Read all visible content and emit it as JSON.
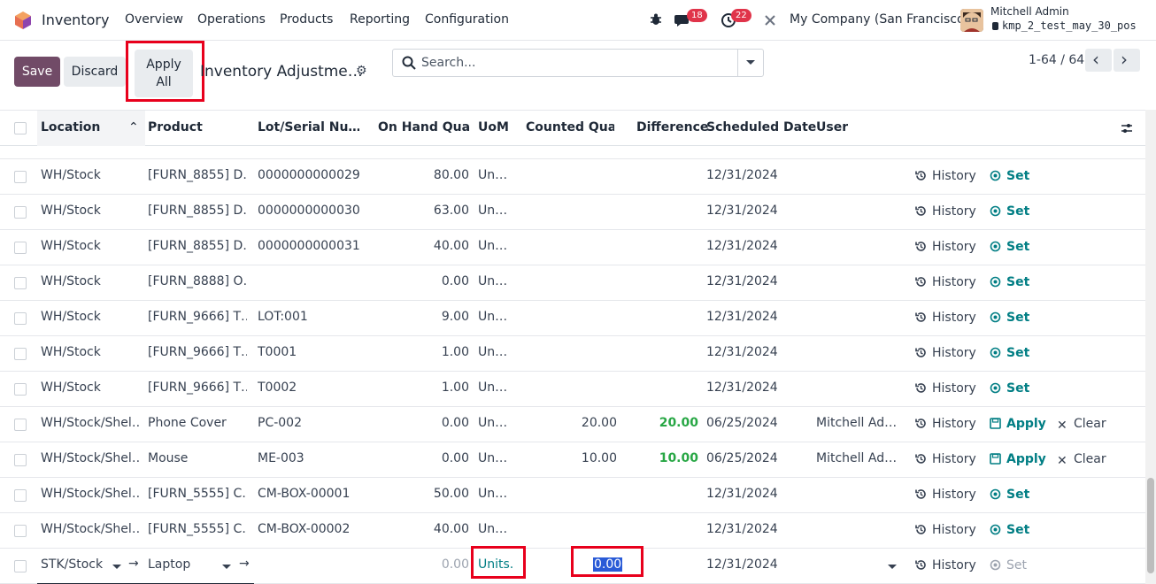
{
  "navbar": {
    "app_name": "Inventory",
    "menu": [
      "Overview",
      "Operations",
      "Products",
      "Reporting",
      "Configuration"
    ],
    "messages_count": "18",
    "activities_count": "22",
    "company": "My Company (San Francisco)",
    "user_name": "Mitchell Admin",
    "database": "kmp_2_test_may_30_pos"
  },
  "control_panel": {
    "save_label": "Save",
    "discard_label": "Discard",
    "apply_all_line1": "Apply",
    "apply_all_line2": "All",
    "breadcrumb": "Inventory Adjustme…",
    "search_placeholder": "Search...",
    "pager_value": "1-64 / 64"
  },
  "table": {
    "columns": [
      "Location",
      "Product",
      "Lot/Serial Nu…",
      "On Hand Qua…",
      "UoM",
      "Counted Qua…",
      "Difference",
      "Scheduled Date",
      "User"
    ],
    "history_label": "History",
    "set_label": "Set",
    "apply_label": "Apply",
    "clear_label": "Clear",
    "rows": [
      {
        "location": "WH/Stock",
        "product": "[FURN_8855] D…",
        "lot": "0000000000029",
        "on_hand": "80.00",
        "uom": "Un…",
        "counted": "",
        "difference": "",
        "date": "12/31/2024",
        "user": "",
        "mode": "set"
      },
      {
        "location": "WH/Stock",
        "product": "[FURN_8855] D…",
        "lot": "0000000000030",
        "on_hand": "63.00",
        "uom": "Un…",
        "counted": "",
        "difference": "",
        "date": "12/31/2024",
        "user": "",
        "mode": "set"
      },
      {
        "location": "WH/Stock",
        "product": "[FURN_8855] D…",
        "lot": "0000000000031",
        "on_hand": "40.00",
        "uom": "Un…",
        "counted": "",
        "difference": "",
        "date": "12/31/2024",
        "user": "",
        "mode": "set"
      },
      {
        "location": "WH/Stock",
        "product": "[FURN_8888] O…",
        "lot": "",
        "on_hand": "0.00",
        "uom": "Un…",
        "counted": "",
        "difference": "",
        "date": "12/31/2024",
        "user": "",
        "mode": "set"
      },
      {
        "location": "WH/Stock",
        "product": "[FURN_9666] T…",
        "lot": "LOT:001",
        "on_hand": "9.00",
        "uom": "Un…",
        "counted": "",
        "difference": "",
        "date": "12/31/2024",
        "user": "",
        "mode": "set"
      },
      {
        "location": "WH/Stock",
        "product": "[FURN_9666] T…",
        "lot": "T0001",
        "on_hand": "1.00",
        "uom": "Un…",
        "counted": "",
        "difference": "",
        "date": "12/31/2024",
        "user": "",
        "mode": "set"
      },
      {
        "location": "WH/Stock",
        "product": "[FURN_9666] T…",
        "lot": "T0002",
        "on_hand": "1.00",
        "uom": "Un…",
        "counted": "",
        "difference": "",
        "date": "12/31/2024",
        "user": "",
        "mode": "set"
      },
      {
        "location": "WH/Stock/Shel…",
        "product": "Phone Cover",
        "lot": "PC-002",
        "on_hand": "0.00",
        "uom": "Un…",
        "counted": "20.00",
        "difference": "20.00",
        "date": "06/25/2024",
        "user": "Mitchell Ad…",
        "mode": "apply"
      },
      {
        "location": "WH/Stock/Shel…",
        "product": "Mouse",
        "lot": "ME-003",
        "on_hand": "0.00",
        "uom": "Un…",
        "counted": "10.00",
        "difference": "10.00",
        "date": "06/25/2024",
        "user": "Mitchell Ad…",
        "mode": "apply"
      },
      {
        "location": "WH/Stock/Shel…",
        "product": "[FURN_5555] C…",
        "lot": "CM-BOX-00001",
        "on_hand": "50.00",
        "uom": "Un…",
        "counted": "",
        "difference": "",
        "date": "12/31/2024",
        "user": "",
        "mode": "set"
      },
      {
        "location": "WH/Stock/Shel…",
        "product": "[FURN_5555] C…",
        "lot": "CM-BOX-00002",
        "on_hand": "40.00",
        "uom": "Un…",
        "counted": "",
        "difference": "",
        "date": "12/31/2024",
        "user": "",
        "mode": "set"
      }
    ],
    "edit_row": {
      "location": "STK/Stock",
      "product": "Laptop",
      "on_hand": "0.00",
      "uom": "Units.",
      "counted": "0.00",
      "date": "12/31/2024"
    }
  }
}
